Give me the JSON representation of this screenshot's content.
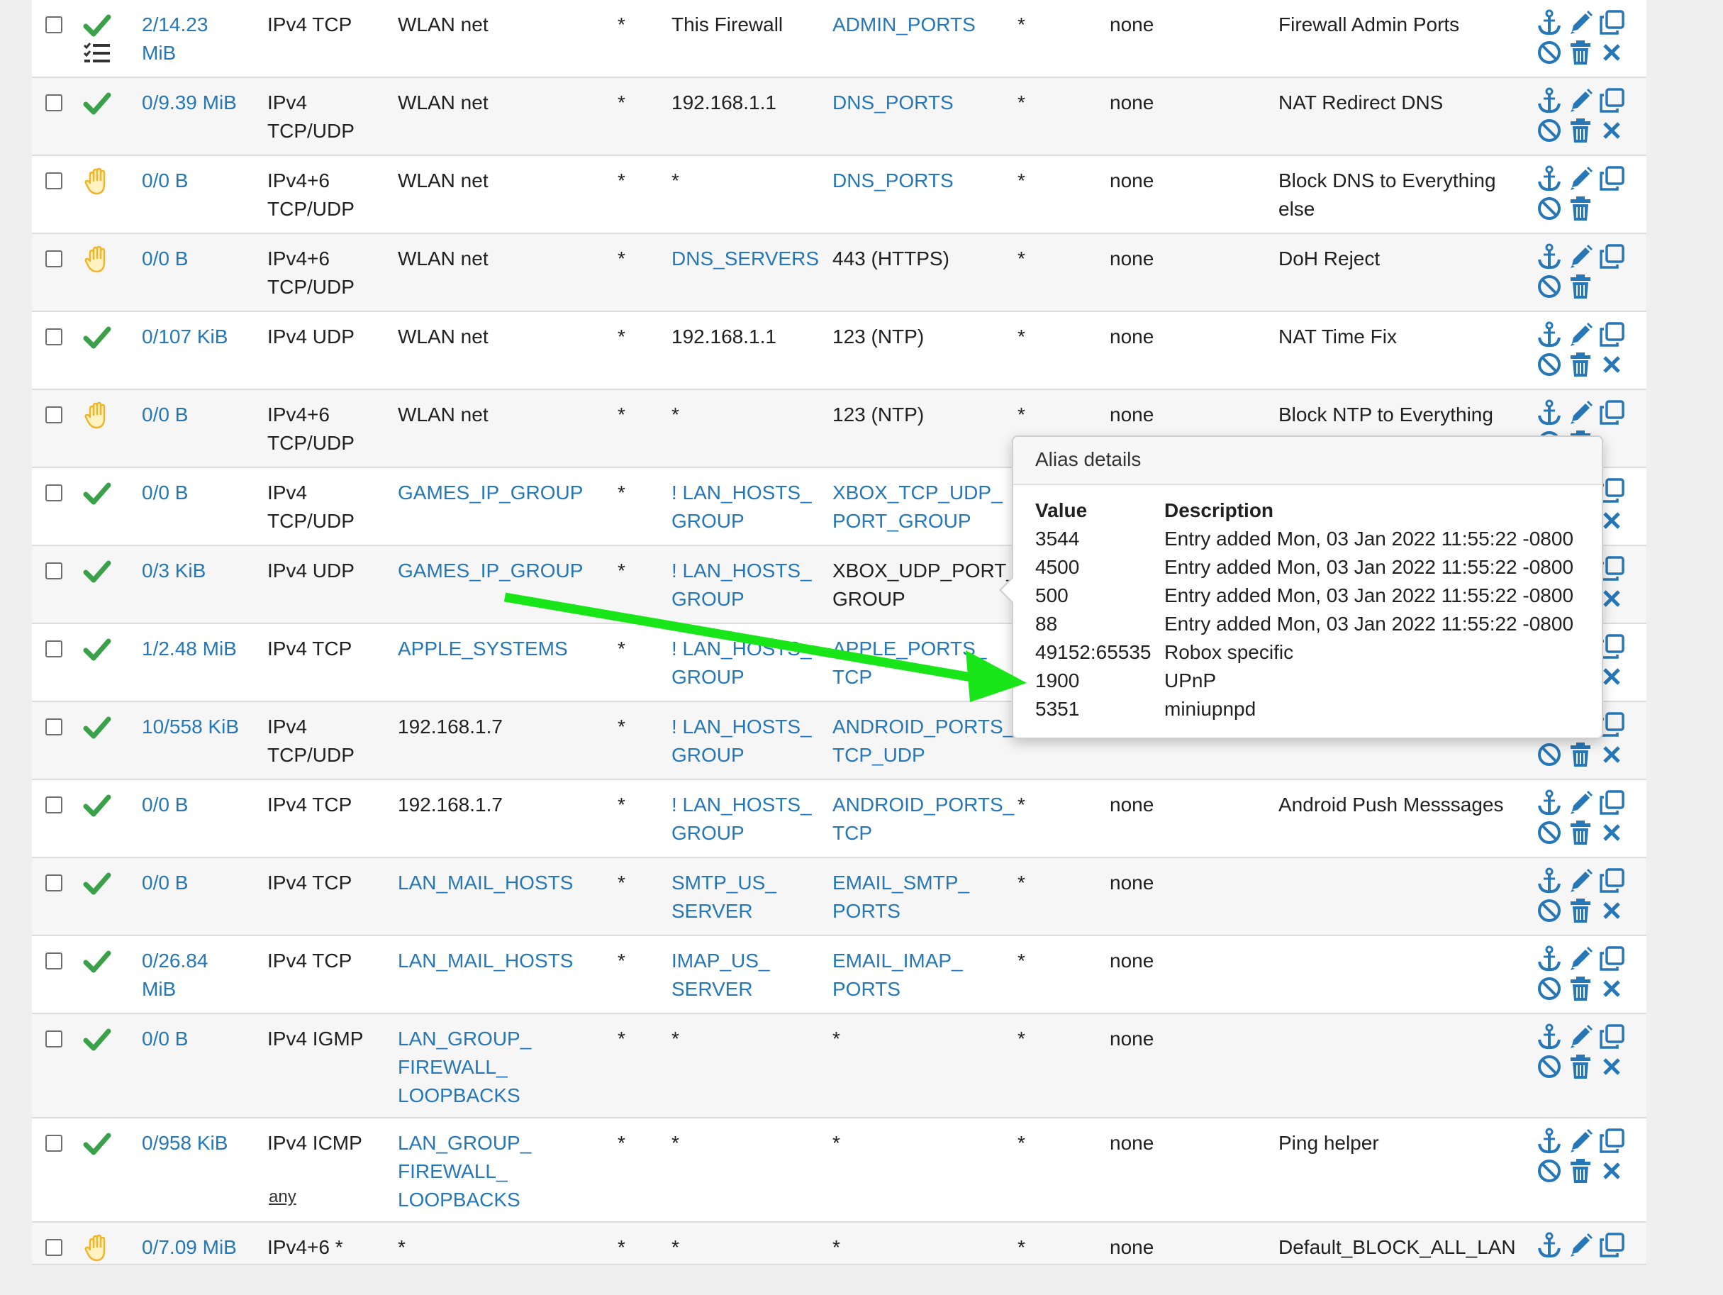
{
  "rules": [
    {
      "status": "pass",
      "extra_icon": "list-icon",
      "states": "2/14.23\nMiB",
      "protocol": "IPv4 TCP",
      "source": "WLAN net",
      "source_link": false,
      "src_port": "*",
      "destination": "This Firewall",
      "dest_link": false,
      "dst_port": "ADMIN_PORTS",
      "dst_port_link": true,
      "gateway": "*",
      "queue": "none",
      "description": "Firewall Admin Ports",
      "actions": [
        "anchor",
        "pencil",
        "copy",
        "ban",
        "trash",
        "times"
      ]
    },
    {
      "status": "pass",
      "states": "0/9.39 MiB",
      "protocol": "IPv4\nTCP/UDP",
      "source": "WLAN net",
      "source_link": false,
      "src_port": "*",
      "destination": "192.168.1.1",
      "dest_link": false,
      "dst_port": "DNS_PORTS",
      "dst_port_link": true,
      "gateway": "*",
      "queue": "none",
      "description": "NAT Redirect DNS",
      "actions": [
        "anchor",
        "pencil",
        "copy",
        "ban",
        "trash",
        "times"
      ]
    },
    {
      "status": "block",
      "states": "0/0 B",
      "protocol": "IPv4+6\nTCP/UDP",
      "source": "WLAN net",
      "source_link": false,
      "src_port": "*",
      "destination": "*",
      "dest_link": false,
      "dst_port": "DNS_PORTS",
      "dst_port_link": true,
      "gateway": "*",
      "queue": "none",
      "description": "Block DNS to Everything\nelse",
      "actions": [
        "anchor",
        "pencil",
        "copy",
        "ban",
        "trash"
      ]
    },
    {
      "status": "block",
      "states": "0/0 B",
      "protocol": "IPv4+6\nTCP/UDP",
      "source": "WLAN net",
      "source_link": false,
      "src_port": "*",
      "destination": "DNS_SERVERS",
      "dest_link": true,
      "dst_port": "443 (HTTPS)",
      "dst_port_link": false,
      "gateway": "*",
      "queue": "none",
      "description": "DoH Reject",
      "actions": [
        "anchor",
        "pencil",
        "copy",
        "ban",
        "trash"
      ]
    },
    {
      "status": "pass",
      "states": "0/107 KiB",
      "protocol": "IPv4 UDP",
      "source": "WLAN net",
      "source_link": false,
      "src_port": "*",
      "destination": "192.168.1.1",
      "dest_link": false,
      "dst_port": "123 (NTP)",
      "dst_port_link": false,
      "gateway": "*",
      "queue": "none",
      "description": "NAT Time Fix",
      "actions": [
        "anchor",
        "pencil",
        "copy",
        "ban",
        "trash",
        "times"
      ]
    },
    {
      "status": "block",
      "states": "0/0 B",
      "protocol": "IPv4+6\nTCP/UDP",
      "source": "WLAN net",
      "source_link": false,
      "src_port": "*",
      "destination": "*",
      "dest_link": false,
      "dst_port": "123 (NTP)",
      "dst_port_link": false,
      "gateway": "*",
      "queue": "none",
      "description": "Block NTP to Everything",
      "actions": [
        "anchor",
        "pencil",
        "copy",
        "ban",
        "trash"
      ]
    },
    {
      "status": "pass",
      "states": "0/0 B",
      "protocol": "IPv4\nTCP/UDP",
      "source": "GAMES_IP_GROUP",
      "source_link": true,
      "src_port": "*",
      "destination": "! LAN_HOSTS_\nGROUP",
      "dest_link": true,
      "dst_port": "XBOX_TCP_UDP_\nPORT_GROUP",
      "dst_port_link": true,
      "gateway": "",
      "queue": "",
      "description": "",
      "actions": [
        "anchor",
        "pencil",
        "copy",
        "ban",
        "trash",
        "times"
      ]
    },
    {
      "status": "pass",
      "states": "0/3 KiB",
      "protocol": "IPv4 UDP",
      "source": "GAMES_IP_GROUP",
      "source_link": true,
      "src_port": "*",
      "destination": "! LAN_HOSTS_\nGROUP",
      "dest_link": true,
      "dst_port": "XBOX_UDP_PORT_\nGROUP",
      "dst_port_link": false,
      "gateway": "",
      "queue": "",
      "description": "",
      "actions": [
        "anchor",
        "pencil",
        "copy",
        "ban",
        "trash",
        "times"
      ]
    },
    {
      "status": "pass",
      "states": "1/2.48 MiB",
      "protocol": "IPv4 TCP",
      "source": "APPLE_SYSTEMS",
      "source_link": true,
      "src_port": "*",
      "destination": "! LAN_HOSTS_\nGROUP",
      "dest_link": true,
      "dst_port": "APPLE_PORTS_\nTCP",
      "dst_port_link": true,
      "gateway": "",
      "queue": "",
      "description": "",
      "actions": [
        "anchor",
        "pencil",
        "copy",
        "ban",
        "trash",
        "times"
      ]
    },
    {
      "status": "pass",
      "states": "10/558 KiB",
      "protocol": "IPv4\nTCP/UDP",
      "source": "192.168.1.7",
      "source_link": false,
      "src_port": "*",
      "destination": "! LAN_HOSTS_\nGROUP",
      "dest_link": true,
      "dst_port": "ANDROID_PORTS_\nTCP_UDP",
      "dst_port_link": true,
      "gateway": "",
      "queue": "",
      "description": "",
      "actions": [
        "anchor",
        "pencil",
        "copy",
        "ban",
        "trash",
        "times"
      ]
    },
    {
      "status": "pass",
      "states": "0/0 B",
      "protocol": "IPv4 TCP",
      "source": "192.168.1.7",
      "source_link": false,
      "src_port": "*",
      "destination": "! LAN_HOSTS_\nGROUP",
      "dest_link": true,
      "dst_port": "ANDROID_PORTS_\nTCP",
      "dst_port_link": true,
      "gateway": "*",
      "queue": "none",
      "description": "Android Push Messsages",
      "actions": [
        "anchor",
        "pencil",
        "copy",
        "ban",
        "trash",
        "times"
      ]
    },
    {
      "status": "pass",
      "states": "0/0 B",
      "protocol": "IPv4 TCP",
      "source": "LAN_MAIL_HOSTS",
      "source_link": true,
      "src_port": "*",
      "destination": "SMTP_US_\nSERVER",
      "dest_link": true,
      "dst_port": "EMAIL_SMTP_\nPORTS",
      "dst_port_link": true,
      "gateway": "*",
      "queue": "none",
      "description": "",
      "actions": [
        "anchor",
        "pencil",
        "copy",
        "ban",
        "trash",
        "times"
      ]
    },
    {
      "status": "pass",
      "states": "0/26.84\nMiB",
      "protocol": "IPv4 TCP",
      "source": "LAN_MAIL_HOSTS",
      "source_link": true,
      "src_port": "*",
      "destination": "IMAP_US_\nSERVER",
      "dest_link": true,
      "dst_port": "EMAIL_IMAP_\nPORTS",
      "dst_port_link": true,
      "gateway": "*",
      "queue": "none",
      "description": "",
      "actions": [
        "anchor",
        "pencil",
        "copy",
        "ban",
        "trash",
        "times"
      ]
    },
    {
      "status": "pass",
      "states": "0/0 B",
      "protocol": "IPv4 IGMP",
      "source": "LAN_GROUP_\nFIREWALL_\nLOOPBACKS",
      "source_link": true,
      "src_port": "*",
      "destination": "*",
      "dest_link": false,
      "dst_port": "*",
      "dst_port_link": false,
      "gateway": "*",
      "queue": "none",
      "description": "",
      "actions": [
        "anchor",
        "pencil",
        "copy",
        "ban",
        "trash",
        "times"
      ]
    },
    {
      "status": "pass",
      "states": "0/958 KiB",
      "protocol": "IPv4 ICMP",
      "protocol_sub": "any",
      "source": "LAN_GROUP_\nFIREWALL_\nLOOPBACKS",
      "source_link": true,
      "src_port": "*",
      "destination": "*",
      "dest_link": false,
      "dst_port": "*",
      "dst_port_link": false,
      "gateway": "*",
      "queue": "none",
      "description": "Ping helper",
      "actions": [
        "anchor",
        "pencil",
        "copy",
        "ban",
        "trash",
        "times"
      ]
    },
    {
      "status": "block",
      "states": "0/7.09 MiB",
      "protocol": "IPv4+6 *",
      "source": "*",
      "source_link": false,
      "src_port": "*",
      "destination": "*",
      "dest_link": false,
      "dst_port": "*",
      "dst_port_link": false,
      "gateway": "*",
      "queue": "none",
      "description": "Default_BLOCK_ALL_LAN",
      "actions": [
        "anchor",
        "pencil",
        "copy"
      ]
    }
  ],
  "alias_popover": {
    "title": "Alias details",
    "value_header": "Value",
    "description_header": "Description",
    "entries": [
      {
        "value": "3544",
        "description": "Entry added Mon, 03 Jan 2022 11:55:22 -0800"
      },
      {
        "value": "4500",
        "description": "Entry added Mon, 03 Jan 2022 11:55:22 -0800"
      },
      {
        "value": "500",
        "description": "Entry added Mon, 03 Jan 2022 11:55:22 -0800"
      },
      {
        "value": "88",
        "description": "Entry added Mon, 03 Jan 2022 11:55:22 -0800"
      },
      {
        "value": "49152:65535",
        "description": "Robox specific"
      },
      {
        "value": "1900",
        "description": "UPnP"
      },
      {
        "value": "5351",
        "description": "miniupnpd"
      }
    ]
  },
  "colors": {
    "link": "#2677b8",
    "pass_check": "#3aa14a",
    "block_hand": "#f0b429",
    "action_icon": "#2677b8",
    "annotation_arrow": "#19e619"
  }
}
